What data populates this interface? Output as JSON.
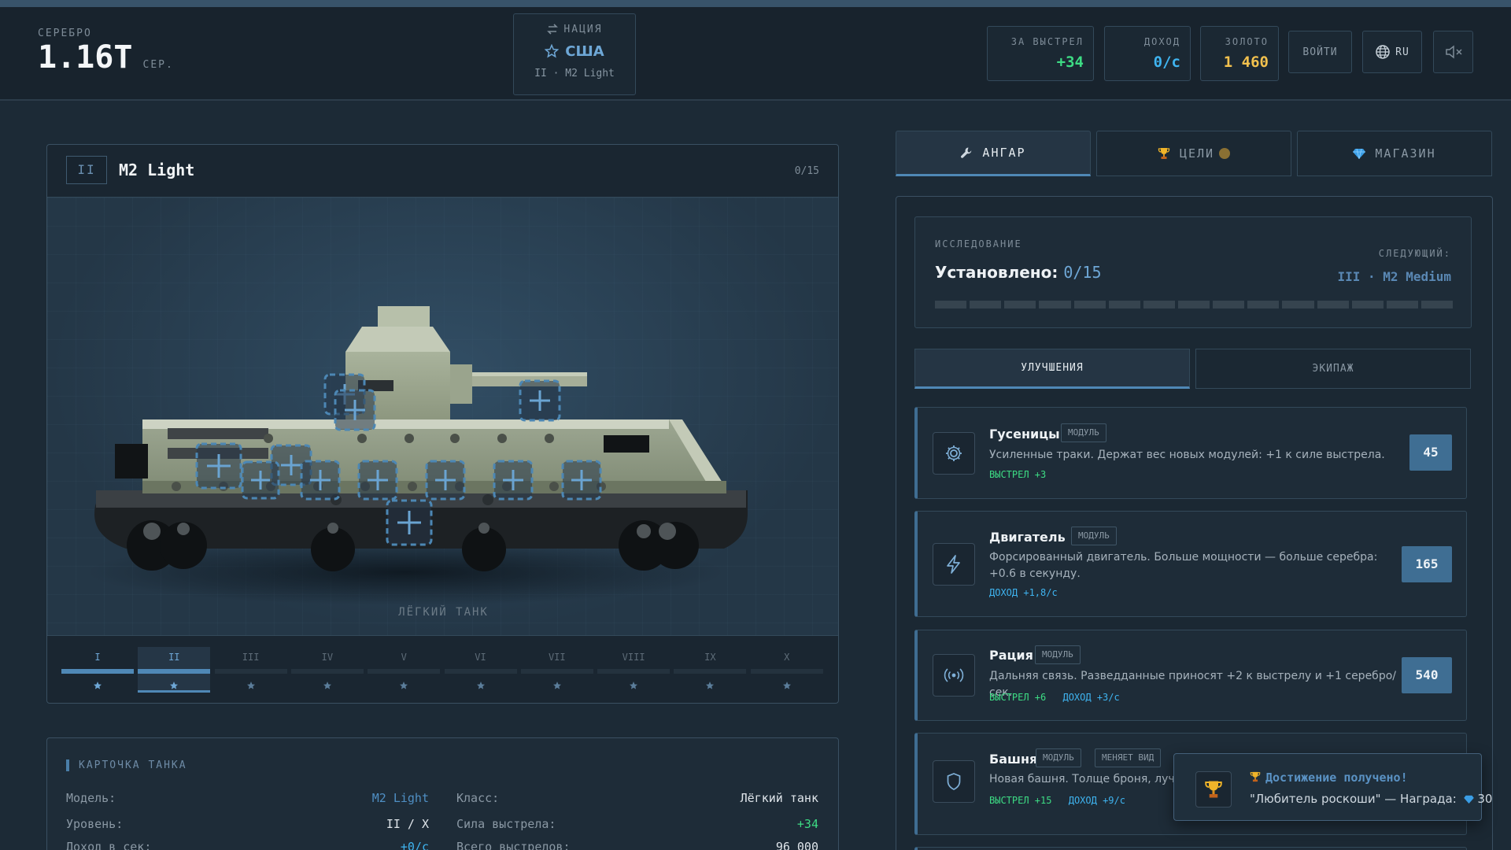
{
  "header": {
    "silver_label": "СЕРЕБРО",
    "silver_value": "1.16T",
    "silver_unit": "СЕР.",
    "nation_label": "НАЦИЯ",
    "nation_name": "США",
    "nation_tank": "II · M2 Light",
    "stats": [
      {
        "label": "ЗА ВЫСТРЕЛ",
        "value": "+34",
        "color": "#3ddc84"
      },
      {
        "label": "ДОХОД",
        "value": "0/с",
        "color": "#3fb4f0"
      },
      {
        "label": "ЗОЛОТО",
        "value": "1 460",
        "color": "#f2c14e"
      }
    ],
    "login_label": "ВОЙТИ",
    "lang_label": "RU"
  },
  "tank": {
    "tier_badge": "II",
    "name": "M2 Light",
    "installed_count": "0/15",
    "class_label": "ЛЁГКИЙ ТАНК",
    "tiers": [
      "I",
      "II",
      "III",
      "IV",
      "V",
      "VI",
      "VII",
      "VIII",
      "IX",
      "X"
    ],
    "current_tier_index": 1
  },
  "card": {
    "title": "КАРТОЧКА ТАНКА",
    "rows": [
      {
        "k": "Модель:",
        "v": "M2 Light",
        "k2": "Класс:",
        "v2": "Лёгкий танк"
      },
      {
        "k": "Уровень:",
        "v": "II / X",
        "k2": "Сила выстрела:",
        "v2": "+34"
      },
      {
        "k": "Доход в сек:",
        "v": "+0/с",
        "k2": "Всего выстрелов:",
        "v2": "96 000"
      }
    ]
  },
  "tabs": [
    {
      "label": "АНГАР",
      "icon": "wrench-icon"
    },
    {
      "label": "ЦЕЛИ",
      "icon": "trophy-icon"
    },
    {
      "label": "МАГАЗИН",
      "icon": "gem-icon"
    }
  ],
  "research": {
    "label": "ИССЛЕДОВАНИЕ",
    "installed_text": "Установлено:",
    "installed_value": "0/15",
    "next_label": "СЛЕДУЮЩИЙ:",
    "next_value": "III · M2 Medium",
    "progress_fraction": 0
  },
  "subtabs": [
    "УЛУЧШЕНИЯ",
    "ЭКИПАЖ"
  ],
  "upgrades": [
    {
      "name": "Гусеницы",
      "icon": "gear-icon",
      "tags": [
        "МОДУЛЬ"
      ],
      "desc": "Усиленные траки. Держат вес новых модулей: +1 к силе выстрела.",
      "effects": [
        {
          "text": "ВЫСТРЕЛ +3",
          "color": "#3ddc84"
        }
      ],
      "price": "45"
    },
    {
      "name": "Двигатель",
      "icon": "lightning-icon",
      "tags": [
        "МОДУЛЬ"
      ],
      "desc": "Форсированный двигатель. Больше мощности — больше серебра: +0.6 в секунду.",
      "effects": [
        {
          "text": "ДОХОД +1,8/с",
          "color": "#3fb4f0"
        }
      ],
      "price": "165"
    },
    {
      "name": "Рация",
      "icon": "radio-icon",
      "tags": [
        "МОДУЛЬ"
      ],
      "desc": "Дальняя связь. Разведданные приносят +2 к выстрелу и +1 серебро/сек.",
      "effects": [
        {
          "text": "ВЫСТРЕЛ +6",
          "color": "#3ddc84"
        },
        {
          "text": "ДОХОД +3/с",
          "color": "#3fb4f0"
        }
      ],
      "price": "540"
    },
    {
      "name": "Башня",
      "icon": "shield-icon",
      "tags": [
        "МОДУЛЬ",
        "МЕНЯЕТ ВИД"
      ],
      "desc": "Новая башня. Толще броня, лучше",
      "effects": [
        {
          "text": "ВЫСТРЕЛ +15",
          "color": "#3ddc84"
        },
        {
          "text": "ДОХОД +9/с",
          "color": "#3fb4f0"
        }
      ],
      "price": ""
    }
  ],
  "toast": {
    "title": "Достижение получено!",
    "text": "\"Любитель роскоши\" — Награда:",
    "reward": "30"
  },
  "colors": {
    "accent": "#4f88b6",
    "shot_green": "#3ddc84",
    "income_blue": "#3fb4f0",
    "gold": "#f2c14e"
  }
}
